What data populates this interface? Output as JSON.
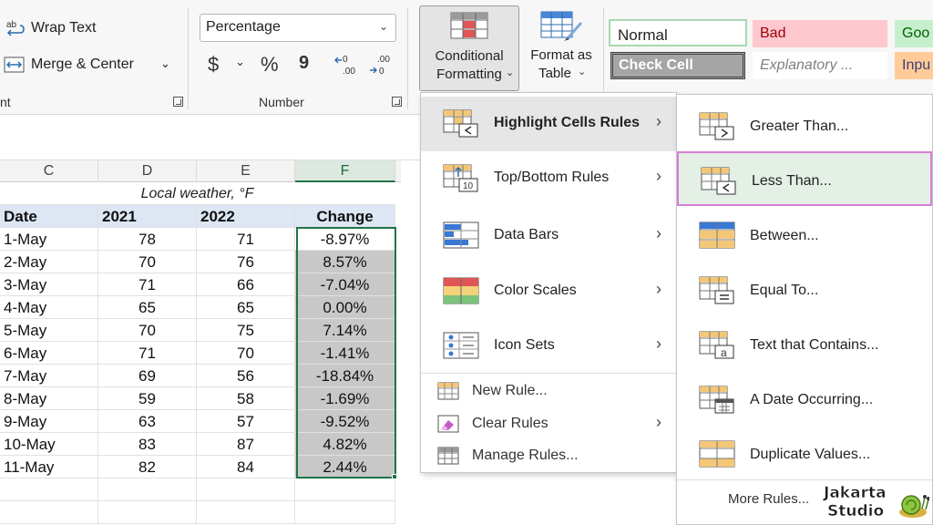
{
  "ribbon": {
    "wrap_text": "Wrap Text",
    "merge_center": "Merge & Center",
    "alignment_group_partial": "nt",
    "number_group": "Number",
    "number_format": "Percentage",
    "currency_symbol": "$",
    "percent_symbol": "%",
    "comma_symbol": "9",
    "conditional_formatting": [
      "Conditional",
      "Formatting"
    ],
    "format_as_table": [
      "Format as",
      "Table"
    ],
    "styles": {
      "normal": "Normal",
      "bad": "Bad",
      "good": "Goo",
      "check_cell": "Check Cell",
      "explanatory": "Explanatory ...",
      "input": "Inpu"
    }
  },
  "sheet": {
    "columns": [
      "C",
      "D",
      "E",
      "F"
    ],
    "title": "Local weather, °F",
    "headers": [
      "Date",
      "2021",
      "2022",
      "Change"
    ],
    "rows": [
      [
        "1-May",
        "78",
        "71",
        "-8.97%"
      ],
      [
        "2-May",
        "70",
        "76",
        "8.57%"
      ],
      [
        "3-May",
        "71",
        "66",
        "-7.04%"
      ],
      [
        "4-May",
        "65",
        "65",
        "0.00%"
      ],
      [
        "5-May",
        "70",
        "75",
        "7.14%"
      ],
      [
        "6-May",
        "71",
        "70",
        "-1.41%"
      ],
      [
        "7-May",
        "69",
        "56",
        "-18.84%"
      ],
      [
        "8-May",
        "59",
        "58",
        "-1.69%"
      ],
      [
        "9-May",
        "63",
        "57",
        "-9.52%"
      ],
      [
        "10-May",
        "83",
        "87",
        "4.82%"
      ],
      [
        "11-May",
        "82",
        "84",
        "2.44%"
      ]
    ]
  },
  "menu": {
    "items": [
      {
        "label": "Highlight Cells Rules",
        "icon": "highlight-cells-icon"
      },
      {
        "label": "Top/Bottom Rules",
        "icon": "top-bottom-icon"
      },
      {
        "label": "Data Bars",
        "icon": "data-bars-icon"
      },
      {
        "label": "Color Scales",
        "icon": "color-scales-icon"
      },
      {
        "label": "Icon Sets",
        "icon": "icon-sets-icon"
      }
    ],
    "new_rule": "New Rule...",
    "clear_rules": "Clear Rules",
    "manage_rules": "Manage Rules..."
  },
  "submenu": {
    "items": [
      {
        "label": "Greater Than..."
      },
      {
        "label": "Less Than..."
      },
      {
        "label": "Between..."
      },
      {
        "label": "Equal To..."
      },
      {
        "label": "Text that Contains..."
      },
      {
        "label": "A Date Occurring..."
      },
      {
        "label": "Duplicate Values..."
      }
    ],
    "more_rules": "More Rules..."
  },
  "watermark": {
    "line1": "Jakarta",
    "line2": "Studio"
  },
  "colors": {
    "excel_green": "#217346",
    "header_fill": "#dde6f3",
    "selection_fill": "#c8c8c8",
    "submenu_highlight_border": "#d67fd6"
  }
}
